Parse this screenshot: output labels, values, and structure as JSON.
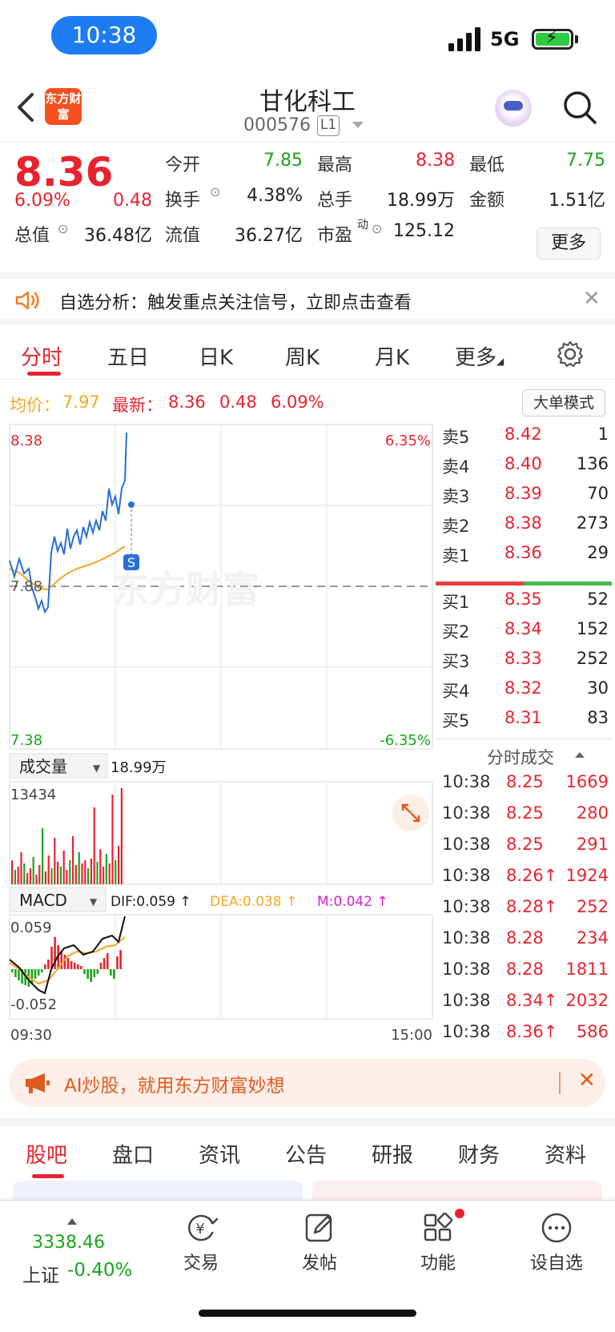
{
  "status": {
    "time": "10:38",
    "network": "5G"
  },
  "header": {
    "logo_text": "东方财富",
    "stock_name": "甘化科工",
    "stock_code": "000576",
    "level": "L1"
  },
  "quote": {
    "price": "8.36",
    "change_pct": "6.09%",
    "change_amt": "0.48",
    "open_label": "今开",
    "open": "7.85",
    "high_label": "最高",
    "high": "8.38",
    "low_label": "最低",
    "low": "7.75",
    "turnover_label": "换手",
    "turnover": "4.38%",
    "volume_label": "总手",
    "volume": "18.99万",
    "amount_label": "金额",
    "amount": "1.51亿",
    "total_cap_label": "总值",
    "total_cap": "36.48亿",
    "float_cap_label": "流值",
    "float_cap": "36.27亿",
    "pe_label": "市盈",
    "pe_sup": "动",
    "pe": "125.12",
    "more_label": "更多"
  },
  "notice": {
    "text": "自选分析：触发重点关注信号，立即点击查看"
  },
  "tabs": [
    "分时",
    "五日",
    "日K",
    "周K",
    "月K",
    "更多"
  ],
  "info_row": {
    "avg_label": "均价：",
    "avg": "7.97",
    "latest_label": "最新：",
    "latest": "8.36",
    "latest_chg": "0.48",
    "latest_pct": "6.09%",
    "big_order_label": "大单模式"
  },
  "intraday": {
    "y_max": "8.38",
    "y_min": "7.38",
    "y_mid": "7.88",
    "pct_max": "6.35%",
    "pct_min": "-6.35%",
    "watermark": "东方财富",
    "marker": "S"
  },
  "volume_panel": {
    "selector": "成交量",
    "total": "18.99万",
    "max": "13434"
  },
  "macd_panel": {
    "selector": "MACD",
    "dif": "DIF:0.059 ↑",
    "dea": "DEA:0.038 ↑",
    "m": "M:0.042 ↑",
    "max": "0.059",
    "min": "-0.052",
    "time_start": "09:30",
    "time_end": "15:00"
  },
  "orderbook": {
    "asks": [
      {
        "label": "卖5",
        "price": "8.42",
        "vol": "1"
      },
      {
        "label": "卖4",
        "price": "8.40",
        "vol": "136"
      },
      {
        "label": "卖3",
        "price": "8.39",
        "vol": "70"
      },
      {
        "label": "卖2",
        "price": "8.38",
        "vol": "273"
      },
      {
        "label": "卖1",
        "price": "8.36",
        "vol": "29"
      }
    ],
    "bids": [
      {
        "label": "买1",
        "price": "8.35",
        "vol": "52"
      },
      {
        "label": "买2",
        "price": "8.34",
        "vol": "152"
      },
      {
        "label": "买3",
        "price": "8.33",
        "vol": "252"
      },
      {
        "label": "买4",
        "price": "8.32",
        "vol": "30"
      },
      {
        "label": "买5",
        "price": "8.31",
        "vol": "83"
      }
    ]
  },
  "ticks": {
    "title": "分时成交",
    "rows": [
      {
        "time": "10:38",
        "price": "8.25",
        "vol": "1669"
      },
      {
        "time": "10:38",
        "price": "8.25",
        "vol": "280"
      },
      {
        "time": "10:38",
        "price": "8.25",
        "vol": "291"
      },
      {
        "time": "10:38",
        "price": "8.26↑",
        "vol": "1924"
      },
      {
        "time": "10:38",
        "price": "8.28↑",
        "vol": "252"
      },
      {
        "time": "10:38",
        "price": "8.28",
        "vol": "234"
      },
      {
        "time": "10:38",
        "price": "8.28",
        "vol": "1811"
      },
      {
        "time": "10:38",
        "price": "8.34↑",
        "vol": "2032"
      },
      {
        "time": "10:38",
        "price": "8.36↑",
        "vol": "586"
      }
    ]
  },
  "ai_banner": {
    "text": "AI炒股，就用东方财富妙想"
  },
  "section_tabs": [
    "股吧",
    "盘口",
    "资讯",
    "公告",
    "研报",
    "财务",
    "资料"
  ],
  "bottom_nav": {
    "index_value": "3338.46",
    "index_name": "上证",
    "index_pct": "-0.40%",
    "items": [
      "交易",
      "发帖",
      "功能",
      "设自选"
    ]
  },
  "colors": {
    "up": "#e8232f",
    "down": "#1aa51c",
    "accent": "#1e7cf2",
    "avg_line": "#f5a623"
  },
  "icons": [
    "back-icon",
    "search-icon",
    "speaker-icon",
    "close-icon",
    "settings-gear-icon",
    "expand-icon",
    "megaphone-icon",
    "trade-yen-icon",
    "post-edit-icon",
    "function-grid-icon",
    "add-watchlist-icon"
  ]
}
